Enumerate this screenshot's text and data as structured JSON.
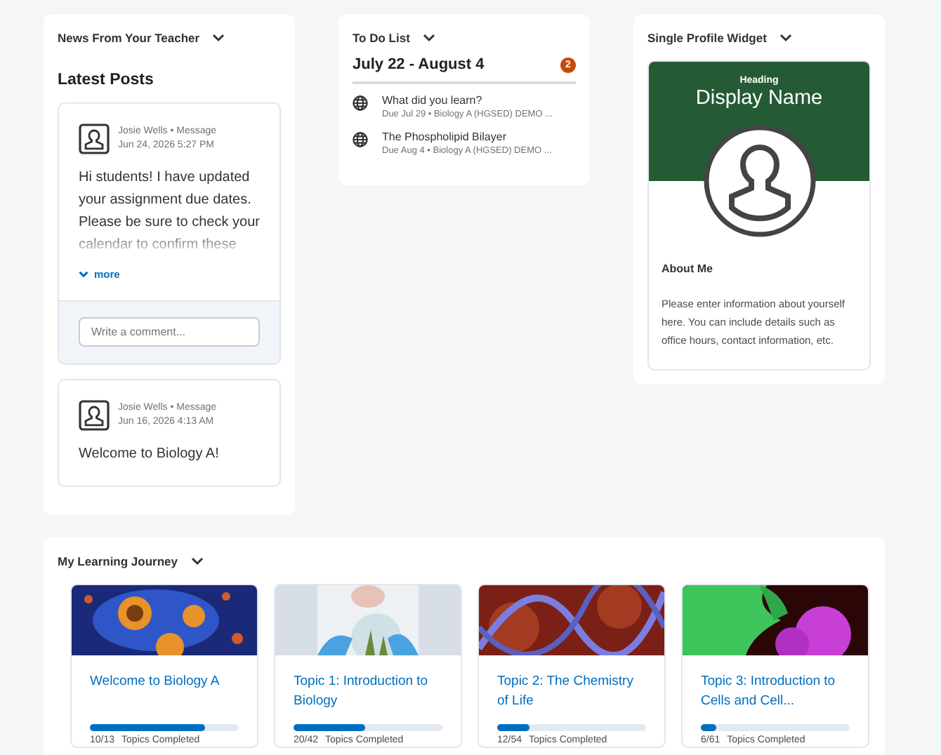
{
  "news": {
    "title": "News From Your Teacher",
    "heading": "Latest Posts",
    "posts": [
      {
        "byline": "Josie Wells • Message",
        "date": "Jun 24, 2026 5:27 PM",
        "body": "Hi students! I have updated your assignment due dates. Please be sure to check your calendar to confirm these",
        "more": "more",
        "comment_placeholder": "Write a comment..."
      },
      {
        "byline": "Josie Wells • Message",
        "date": "Jun 16, 2026 4:13 AM",
        "body": "Welcome to Biology A!"
      }
    ]
  },
  "todo": {
    "title": "To Do List",
    "range": "July 22 - August 4",
    "count": "2",
    "items": [
      {
        "title": "What did you learn?",
        "meta": "Due Jul 29 • Biology A (HGSED) DEMO ..."
      },
      {
        "title": "The Phospholipid Bilayer",
        "meta": "Due Aug 4 • Biology A (HGSED) DEMO ..."
      }
    ]
  },
  "profile": {
    "title": "Single Profile Widget",
    "heading": "Heading",
    "name": "Display Name",
    "about_title": "About Me",
    "about_text": "Please enter information about yourself here. You can include details such as office hours, contact information, etc."
  },
  "journey": {
    "title": "My Learning Journey",
    "courses": [
      {
        "title": "Welcome to Biology A",
        "level": 0.77,
        "progress": "10/13",
        "label": "Topics Completed"
      },
      {
        "title": "Topic 1: Introduction to Biology",
        "level": 0.48,
        "progress": "20/42",
        "label": "Topics Completed"
      },
      {
        "title": "Topic 2: The Chemistry of Life",
        "level": 0.22,
        "progress": "12/54",
        "label": "Topics Completed"
      },
      {
        "title": "Topic 3: Introduction to Cells and Cell...",
        "level": 0.1,
        "progress": "6/61",
        "label": "Topics Completed"
      }
    ]
  }
}
